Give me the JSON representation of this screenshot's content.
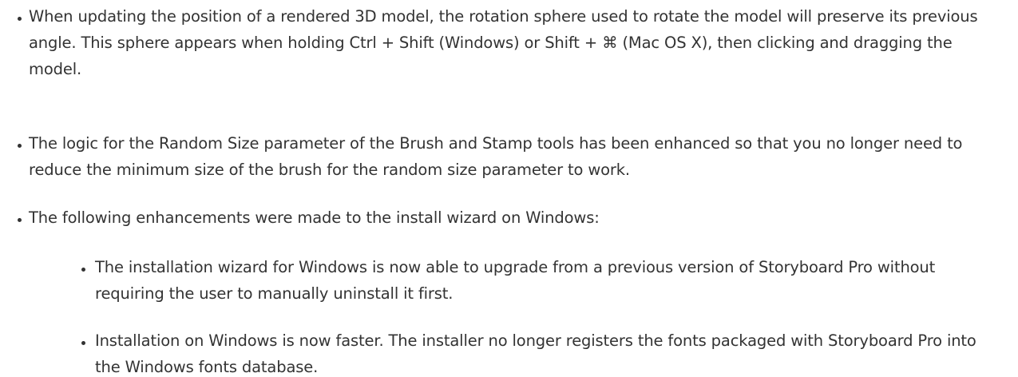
{
  "bullets": [
    {
      "text": "When updating the position of a rendered 3D model, the rotation sphere used to rotate the model will preserve its previous angle. This sphere appears when holding Ctrl + Shift (Windows) or Shift + ⌘ (Mac OS X), then clicking and dragging the model."
    },
    {
      "text": "The logic for the Random Size parameter of the Brush and Stamp tools has been enhanced so that you no longer need to reduce the minimum size of the brush for the random size parameter to work."
    },
    {
      "text": "The following enhancements were made to the install wizard on Windows:",
      "sub_bullets": [
        {
          "text": "The installation wizard for Windows is now able to upgrade from a previous version of Storyboard Pro without requiring the user to manually uninstall it first."
        },
        {
          "text": "Installation on Windows is now faster. The installer no longer registers the fonts packaged with Storyboard Pro into the Windows fonts database."
        }
      ]
    }
  ]
}
